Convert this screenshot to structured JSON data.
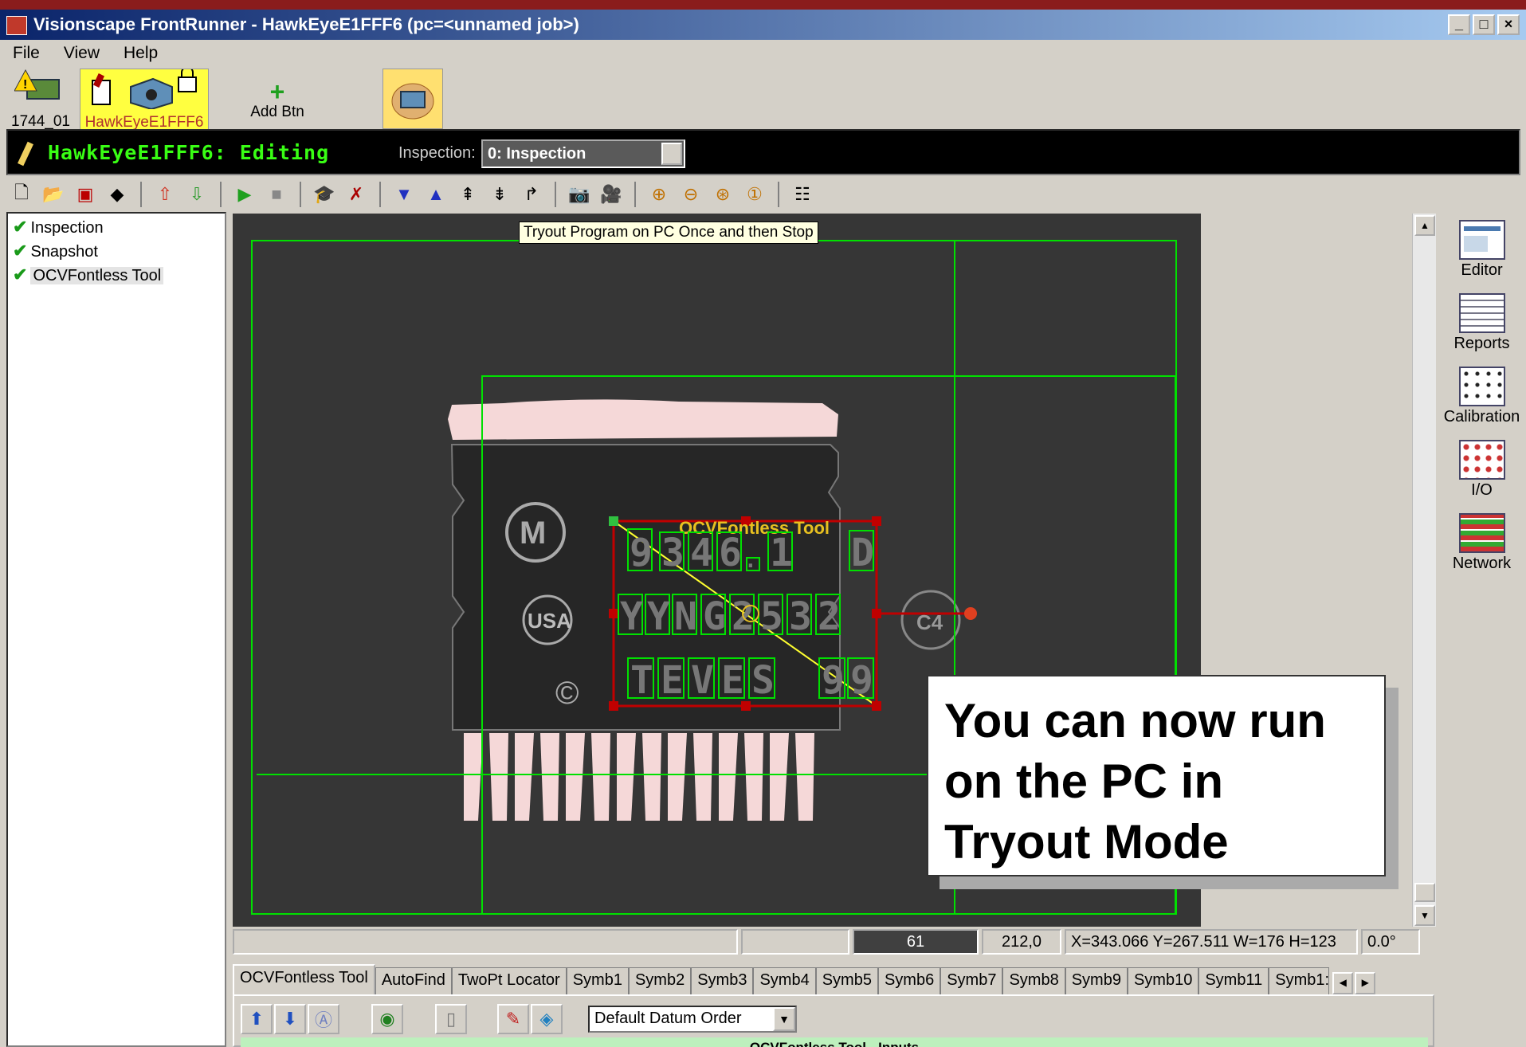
{
  "window": {
    "title": "Visionscape FrontRunner - HawkEyeE1FFF6 (pc=<unnamed job>)",
    "btn_min": "_",
    "btn_max": "□",
    "btn_close": "×"
  },
  "menu": [
    "File",
    "View",
    "Help"
  ],
  "devices": {
    "device1": "1744_01",
    "device2": "HawkEyeE1FFF6",
    "add": "Add Btn"
  },
  "editbar": {
    "title": "HawkEyeE1FFF6: Editing",
    "inspection_label": "Inspection:",
    "inspection_value": "0: Inspection"
  },
  "tree": [
    "Inspection",
    "Snapshot",
    "OCVFontless Tool"
  ],
  "tooltip": "Tryout Program on PC Once and then Stop",
  "image": {
    "tool_label": "OCVFontless Tool",
    "row1": [
      "9",
      "3",
      "4",
      "6",
      ".",
      "1",
      "D"
    ],
    "row2": [
      "Y",
      "Y",
      "N",
      "G",
      "2",
      "5",
      "3",
      "2"
    ],
    "row3": [
      "T",
      "E",
      "V",
      "E",
      "S",
      "9",
      "9"
    ],
    "logo_text": "USA",
    "c_mark": "©",
    "c4": "C4"
  },
  "callout": "You can now run on the PC in Tryout Mode",
  "side": [
    "Editor",
    "Reports",
    "Calibration",
    "I/O",
    "Network"
  ],
  "status": {
    "value": "61",
    "pos": "212,0",
    "region": "X=343.066 Y=267.511 W=176 H=123",
    "angle": "0.0°"
  },
  "tabs": [
    "OCVFontless Tool",
    "AutoFind",
    "TwoPt Locator",
    "Symb1",
    "Symb2",
    "Symb3",
    "Symb4",
    "Symb5",
    "Symb6",
    "Symb7",
    "Symb8",
    "Symb9",
    "Symb10",
    "Symb11",
    "Symb1:"
  ],
  "panel": {
    "datum": "Default Datum Order",
    "inputs_title": "OCVFontless Tool - Inputs"
  },
  "colors": {
    "accent_green": "#39ff14",
    "roi_green": "#00e000",
    "roi_red": "#c00000",
    "editbar_bg": "#000000",
    "title_gradient_start": "#0a246a"
  }
}
